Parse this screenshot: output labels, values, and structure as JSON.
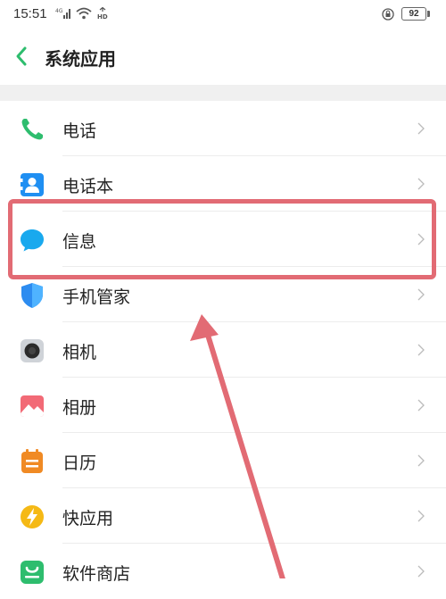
{
  "status_bar": {
    "time": "15:51",
    "battery": "92"
  },
  "header": {
    "title": "系统应用"
  },
  "apps": [
    {
      "label": "电话",
      "icon": "phone-icon"
    },
    {
      "label": "电话本",
      "icon": "contacts-icon"
    },
    {
      "label": "信息",
      "icon": "messages-icon"
    },
    {
      "label": "手机管家",
      "icon": "phone-manager-icon"
    },
    {
      "label": "相机",
      "icon": "camera-icon"
    },
    {
      "label": "相册",
      "icon": "gallery-icon"
    },
    {
      "label": "日历",
      "icon": "calendar-icon"
    },
    {
      "label": "快应用",
      "icon": "quick-app-icon"
    },
    {
      "label": "软件商店",
      "icon": "app-store-icon"
    }
  ],
  "colors": {
    "accent": "#2ebd6e",
    "highlight": "#e26b74"
  }
}
